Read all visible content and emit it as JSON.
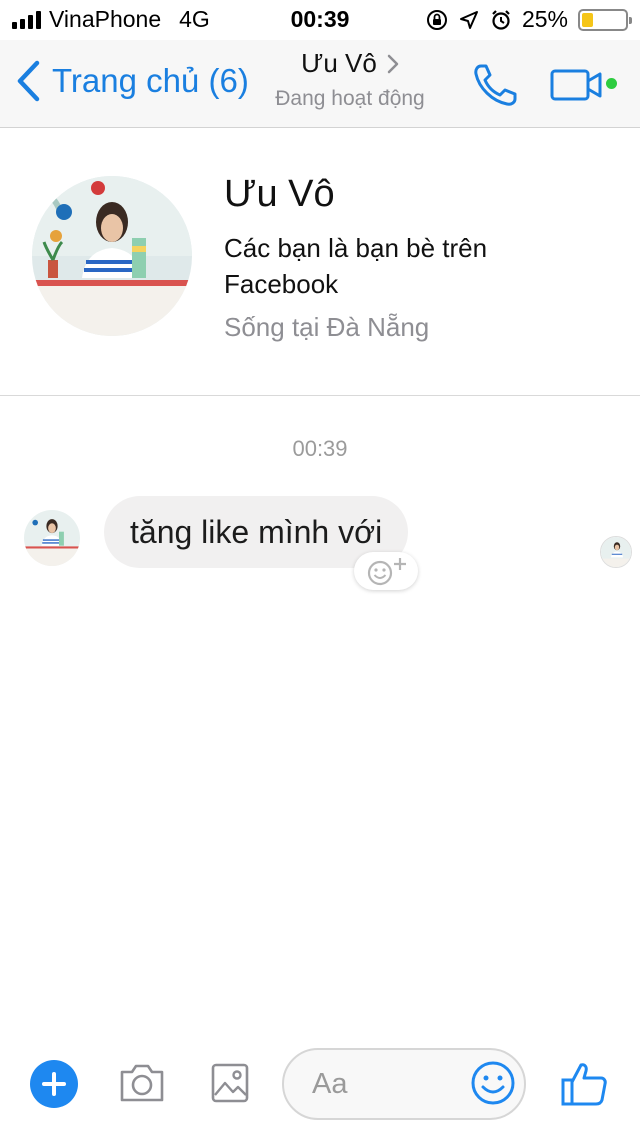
{
  "status_bar": {
    "carrier": "VinaPhone",
    "network": "4G",
    "time": "00:39",
    "battery_percent": "25%",
    "battery_level": 0.25,
    "battery_color": "#f5c518"
  },
  "nav": {
    "back_label": "Trang chủ (6)",
    "contact_name": "Ưu Vô",
    "status": "Đang hoạt động",
    "accent_color": "#1a7fe0",
    "online_color": "#2ecc40"
  },
  "profile": {
    "name": "Ưu Vô",
    "friends_text": "Các bạn là bạn bè trên Facebook",
    "location": "Sống tại Đà Nẵng"
  },
  "conversation": {
    "timestamp": "00:39",
    "messages": [
      {
        "text": "tăng like mình với"
      }
    ]
  },
  "composer": {
    "placeholder": "Aa",
    "accent_color": "#1e88f0"
  },
  "icons": [
    "signal-icon",
    "orientation-lock-icon",
    "location-arrow-icon",
    "alarm-icon",
    "battery-icon",
    "chevron-left-icon",
    "chevron-right-icon",
    "phone-icon",
    "video-camera-icon",
    "add-reaction-icon",
    "plus-icon",
    "camera-icon",
    "image-icon",
    "emoji-icon",
    "thumbs-up-icon"
  ]
}
